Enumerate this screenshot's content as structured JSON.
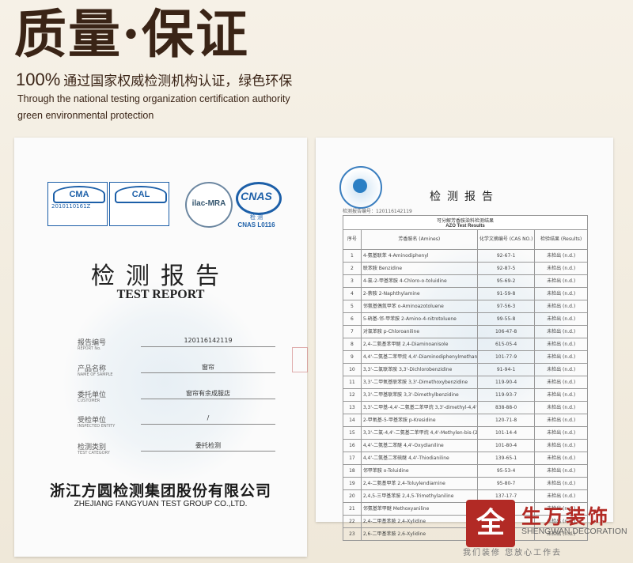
{
  "header": {
    "title": "质量·保证",
    "percent": "100%",
    "subtitle_zh": "通过国家权威检测机构认证，绿色环保",
    "subtitle_en_line1": "Through the national testing organization certification authority",
    "subtitle_en_line2": "green environmental protection"
  },
  "left_doc": {
    "logos": {
      "cma_mark": "CMA",
      "cma_number": "2010110161Z",
      "cal_mark": "CAL",
      "ilac": "ilac-MRA",
      "cnas": "CNAS",
      "cnas_sub_zh": "检 测",
      "cnas_code": "CNAS L0116"
    },
    "title_zh": "检测报告",
    "title_en": "TEST REPORT",
    "fields": [
      {
        "label": "报告编号",
        "label_en": "REPORT No.",
        "value": "120116142119"
      },
      {
        "label": "产品名称",
        "label_en": "NAME OF SAMPLE",
        "value": "窗帘"
      },
      {
        "label": "委托单位",
        "label_en": "CUSTOMER",
        "value": "窗帘有余成服店"
      },
      {
        "label": "受检单位",
        "label_en": "INSPECTED ENTITY",
        "value": "/"
      },
      {
        "label": "检测类别",
        "label_en": "TEST CATEGORY",
        "value": "委托检测"
      }
    ],
    "company_zh": "浙江方圆检测集团股份有限公司",
    "company_en": "ZHEJIANG FANGYUAN TEST GROUP CO.,LTD."
  },
  "right_doc": {
    "title": "检测报告",
    "report_no": "检测报告编号：120116142119",
    "table_caption": "可分解芳香胺染料检测结果",
    "table_caption_en": "AZO Test Results",
    "headers": [
      "序号",
      "芳香胺名 (Amines)",
      "化学文摘编号 (CAS NO.)",
      "检验结果 (Results)"
    ],
    "rows": [
      [
        "1",
        "4-氨基联苯 4-Aminodiphenyl",
        "92-67-1",
        "未检出 (n.d.)"
      ],
      [
        "2",
        "联苯胺 Benzidine",
        "92-87-5",
        "未检出 (n.d.)"
      ],
      [
        "3",
        "4-氯-2-甲基苯胺 4-Chloro-o-toluidine",
        "95-69-2",
        "未检出 (n.d.)"
      ],
      [
        "4",
        "2-萘胺 2-Naphthylamine",
        "91-59-8",
        "未检出 (n.d.)"
      ],
      [
        "5",
        "邻氨基偶氮甲苯 o-Aminoazotoluene",
        "97-56-3",
        "未检出 (n.d.)"
      ],
      [
        "6",
        "5-硝基-邻-甲苯胺 2-Amino-4-nitrotoluene",
        "99-55-8",
        "未检出 (n.d.)"
      ],
      [
        "7",
        "对氯苯胺 p-Chloroaniline",
        "106-47-8",
        "未检出 (n.d.)"
      ],
      [
        "8",
        "2,4-二氨基苯甲醚 2,4-Diaminoanisole",
        "615-05-4",
        "未检出 (n.d.)"
      ],
      [
        "9",
        "4,4'-二氨基二苯甲烷 4,4'-Diaminodiphenylmethane",
        "101-77-9",
        "未检出 (n.d.)"
      ],
      [
        "10",
        "3,3'-二氯联苯胺 3,3'-Dichlorobenzidine",
        "91-94-1",
        "未检出 (n.d.)"
      ],
      [
        "11",
        "3,3'-二甲氧基联苯胺 3,3'-Dimethoxybenzidine",
        "119-90-4",
        "未检出 (n.d.)"
      ],
      [
        "12",
        "3,3'-二甲基联苯胺 3,3'-Dimethylbenzidine",
        "119-93-7",
        "未检出 (n.d.)"
      ],
      [
        "13",
        "3,3'-二甲基-4,4'-二氨基二苯甲烷 3,3'-dimethyl-4,4'-diaminodiphenylmethane",
        "838-88-0",
        "未检出 (n.d.)"
      ],
      [
        "14",
        "2-甲氧基-5-甲基苯胺 p-Kresidine",
        "120-71-8",
        "未检出 (n.d.)"
      ],
      [
        "15",
        "3,3'-二氯-4,4'-二氨基二苯甲烷 4,4'-Methylen-bis-(2-chloraniline)",
        "101-14-4",
        "未检出 (n.d.)"
      ],
      [
        "16",
        "4,4'-二氨基二苯醚 4,4'-Oxydianiline",
        "101-80-4",
        "未检出 (n.d.)"
      ],
      [
        "17",
        "4,4'-二氨基二苯硫醚 4,4'-Thiodianiline",
        "139-65-1",
        "未检出 (n.d.)"
      ],
      [
        "18",
        "邻甲苯胺 o-Toluidine",
        "95-53-4",
        "未检出 (n.d.)"
      ],
      [
        "19",
        "2,4-二氨基甲苯 2,4-Toluylendiamine",
        "95-80-7",
        "未检出 (n.d.)"
      ],
      [
        "20",
        "2,4,5-三甲基苯胺 2,4,5-Trimethylaniline",
        "137-17-7",
        "未检出 (n.d.)"
      ],
      [
        "21",
        "邻氨基苯甲醚 Methoxyaniline",
        "90-04-0",
        "未检出 (n.d.)"
      ],
      [
        "22",
        "2,4-二甲基苯胺 2,4-Xylidine",
        "95-68-1",
        "未检出 (n.d.)"
      ],
      [
        "23",
        "2,6-二甲基苯胺 2,6-Xylidine",
        "87-62-7",
        "未检出 (n.d.)"
      ]
    ]
  },
  "brand": {
    "glyph": "全",
    "name_zh": "生万装饰",
    "name_en": "SHENGWAN DECORATION",
    "slogan": "我们装修  您放心工作去"
  },
  "colors": {
    "brand_red": "#b22a25",
    "title_brown": "#3a2416",
    "cert_blue": "#1c5fa8"
  }
}
